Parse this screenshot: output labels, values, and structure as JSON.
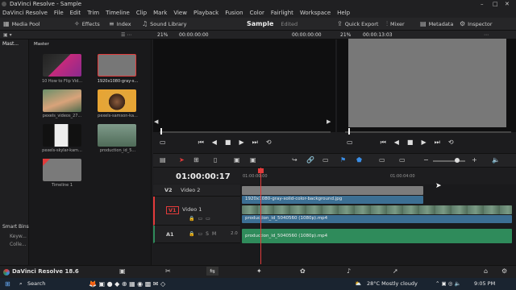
{
  "window": {
    "title": "DaVinci Resolve - Sample"
  },
  "menu": [
    "DaVinci Resolve",
    "File",
    "Edit",
    "Trim",
    "Timeline",
    "Clip",
    "Mark",
    "View",
    "Playback",
    "Fusion",
    "Color",
    "Fairlight",
    "Workspace",
    "Help"
  ],
  "toolbar": {
    "media_pool": "Media Pool",
    "effects": "Effects",
    "index": "Index",
    "sound_library": "Sound Library",
    "project": "Sample",
    "status": "Edited",
    "quick_export": "Quick Export",
    "mixer": "Mixer",
    "metadata": "Metadata",
    "inspector": "Inspector"
  },
  "subbar": {
    "zoom_left": "21%",
    "tc_left": "00:00:00:00",
    "tc_mid": "00:00:00:00",
    "zoom_right": "21%",
    "tc_right": "00:00:13:03"
  },
  "bins": {
    "master": "Mast...",
    "smart_bins": "Smart Bins",
    "keywords": "Keyw...",
    "collections": "Colle..."
  },
  "media_pool": {
    "header": "Master",
    "items": [
      {
        "label": "10 How to Flip Vid..."
      },
      {
        "label": "1920x1080-gray-s..."
      },
      {
        "label": "pexels_videos_27..."
      },
      {
        "label": "pexels-samson-ka..."
      },
      {
        "label": "pexels-skylar-kam..."
      },
      {
        "label": "production_id_5..."
      },
      {
        "label": "Timeline 1"
      }
    ]
  },
  "timeline": {
    "timecode": "01:00:00:17",
    "ruler": [
      "01:00:00:00",
      "01:00:04:00"
    ],
    "tracks": [
      {
        "id": "V2",
        "name": "Video 2"
      },
      {
        "id": "V1",
        "name": "Video 1"
      },
      {
        "id": "A1",
        "name": "",
        "level": "2.0"
      }
    ],
    "clips": {
      "v2": "1920x1080-gray-solid-color-background.jpg",
      "v1": "production_id_5040560 (1080p).mp4",
      "a1": "production_id_5040560 (1080p).mp4"
    }
  },
  "version": "DaVinci Resolve 18.6",
  "taskbar": {
    "search": "Search",
    "weather": "28°C  Mostly cloudy",
    "time": "9:05 PM"
  },
  "colors": {
    "accent_red": "#e23b3b",
    "video_clip": "#3c6f93",
    "audio_clip": "#2f8b5b"
  }
}
